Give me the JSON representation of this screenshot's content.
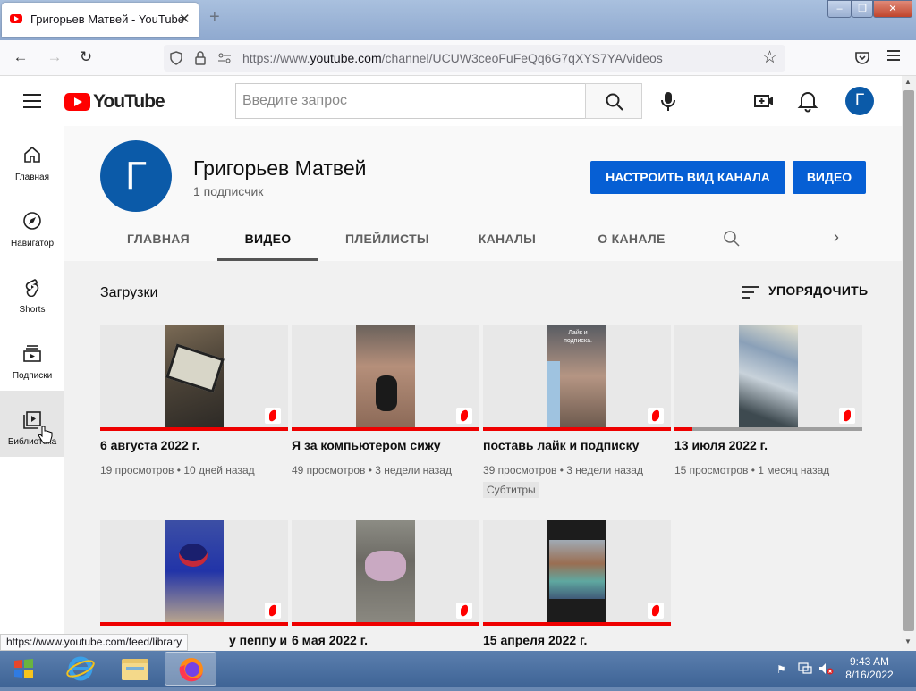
{
  "browser": {
    "tab_title": "Григорьев Матвей - YouTube",
    "tab_close": "✕",
    "new_tab": "+",
    "url_prefix": "https://www.",
    "url_domain": "youtube.com",
    "url_path": "/channel/UCUW3ceoFuFeQq6G7qXYS7YA/videos",
    "status_url": "https://www.youtube.com/feed/library"
  },
  "youtube": {
    "logo_text": "YouTube",
    "search_placeholder": "Введите запрос",
    "avatar_letter": "Г"
  },
  "sidebar": [
    {
      "label": "Главная",
      "icon": "home-icon"
    },
    {
      "label": "Навигатор",
      "icon": "compass-icon"
    },
    {
      "label": "Shorts",
      "icon": "shorts-icon"
    },
    {
      "label": "Подписки",
      "icon": "subscriptions-icon"
    },
    {
      "label": "Библиотека",
      "icon": "library-icon"
    }
  ],
  "channel": {
    "avatar_letter": "Г",
    "name": "Григорьев Матвей",
    "subscribers": "1 подписчик",
    "customize_button": "НАСТРОИТЬ ВИД КАНАЛА",
    "video_button": "ВИДЕО"
  },
  "tabs": [
    "ГЛАВНАЯ",
    "ВИДЕО",
    "ПЛЕЙЛИСТЫ",
    "КАНАЛЫ",
    "О КАНАЛЕ"
  ],
  "section": {
    "title": "Загрузки",
    "sort_label": "УПОРЯДОЧИТЬ"
  },
  "videos": [
    {
      "title": "6 августа 2022 г.",
      "views": "19 просмотров",
      "age": "10 дней назад"
    },
    {
      "title": "Я за компьютером сижу",
      "views": "49 просмотров",
      "age": "3 недели назад"
    },
    {
      "title": "поставь лайк и подписку",
      "views": "39 просмотров",
      "age": "3 недели назад",
      "badge": "Субтитры",
      "thumb_text": "Лайк и подписка."
    },
    {
      "title": "13 июля 2022 г.",
      "views": "15 просмотров",
      "age": "1 месяц назад"
    },
    {
      "title": "у пеппу и",
      "views": "",
      "age": ""
    },
    {
      "title": "6 мая 2022 г.",
      "views": "",
      "age": ""
    },
    {
      "title": "15 апреля 2022 г.",
      "views": "",
      "age": ""
    }
  ],
  "taskbar": {
    "time": "9:43 AM",
    "date": "8/16/2022"
  },
  "colors": {
    "accent": "#065fd4",
    "youtube_red": "#ff0000",
    "avatar": "#0b5aa8"
  }
}
